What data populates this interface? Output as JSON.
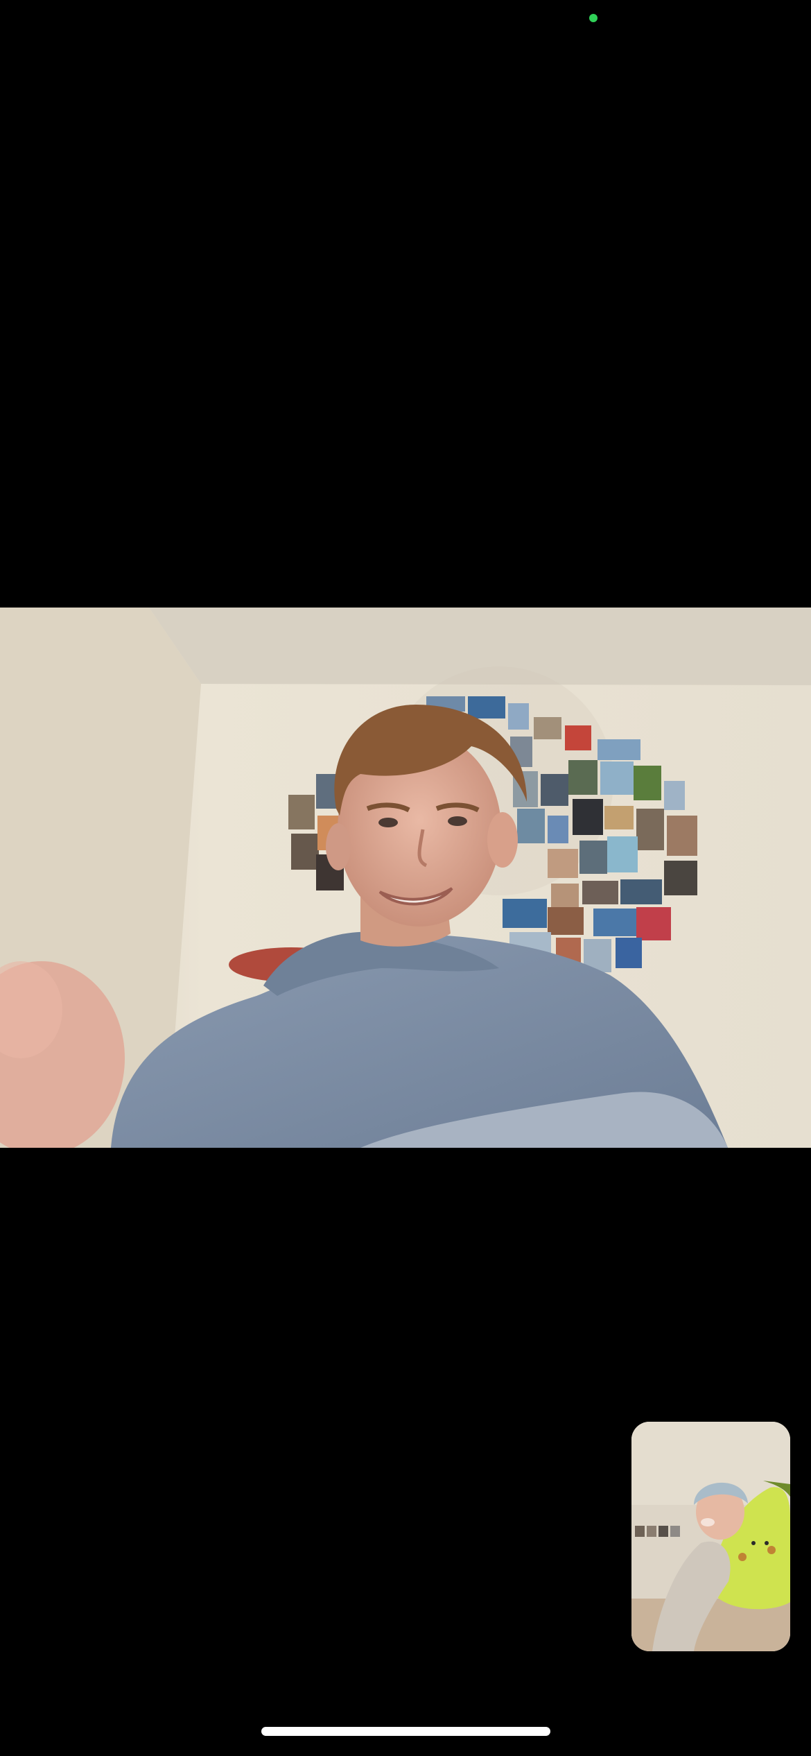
{
  "colors": {
    "background": "#000000",
    "camera_indicator": "#30d158",
    "home_indicator": "#ffffff",
    "wall": "#e8e1d2",
    "ceiling": "#d9d2c4",
    "shirt": "#7b8ca3"
  },
  "icons": {
    "camera_indicator": "green-dot-icon"
  }
}
